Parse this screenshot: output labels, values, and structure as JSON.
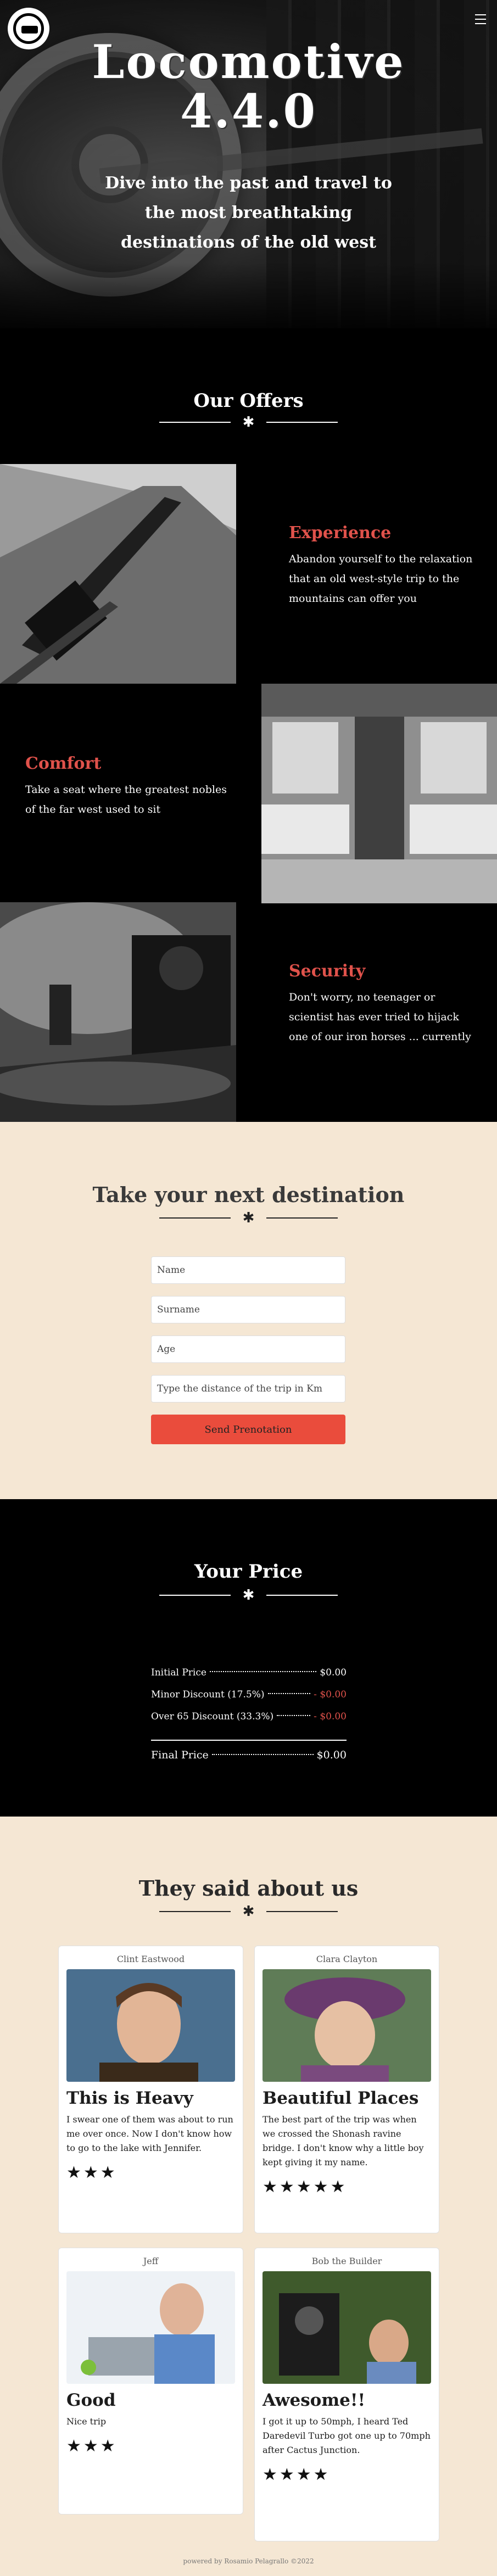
{
  "hero": {
    "title_line1": "Locomotive",
    "title_line2": "4.4.0",
    "subtitle": "Dive into the past and travel to the most breathtaking destinations of the old west"
  },
  "offers": {
    "heading": "Our Offers",
    "items": [
      {
        "title": "Experience",
        "text": "Abandon yourself to the relaxation that an old west-style trip to the mountains can offer you"
      },
      {
        "title": "Comfort",
        "text": "Take a seat where the greatest nobles of the far west used to sit"
      },
      {
        "title": "Security",
        "text": "Don't worry, no teenager or scientist has ever tried to hijack one of our iron horses ... currently"
      }
    ]
  },
  "destination": {
    "heading": "Take your next destination",
    "fields": {
      "name_placeholder": "Name",
      "surname_placeholder": "Surname",
      "age_placeholder": "Age",
      "distance_placeholder": "Type the distance of the trip in Km"
    },
    "submit_label": "Send Prenotation"
  },
  "price": {
    "heading": "Your Price",
    "rows": [
      {
        "label": "Initial Price",
        "value": "$0.00"
      },
      {
        "label": "Minor Discount (17.5%)",
        "value": "- $0.00"
      },
      {
        "label": "Over 65 Discount (33.3%)",
        "value": "- $0.00"
      }
    ],
    "final": {
      "label": "Final Price",
      "value": "$0.00"
    }
  },
  "reviews": {
    "heading": "They said about us",
    "cards": [
      {
        "author": "Clint Eastwood",
        "title": "This is Heavy",
        "text": "I swear one of them was about to run me over once. Now I don't know how to go to the lake with Jennifer.",
        "stars": "★★★"
      },
      {
        "author": "Clara Clayton",
        "title": "Beautiful Places",
        "text": "The best part of the trip was when we crossed the Shonash ravine bridge. I don't know why a little boy kept giving it my name.",
        "stars": "★★★★★"
      },
      {
        "author": "Jeff",
        "title": "Good",
        "text": "Nice trip",
        "stars": "★★★"
      },
      {
        "author": "Bob the Builder",
        "title": "Awesome!!",
        "text": "I got it up to 50mph, I heard Ted Daredevil Turbo got one up to 70mph after Cactus Junction.",
        "stars": "★★★★"
      }
    ]
  },
  "footer": {
    "text": "powered by Rosamio Pelagrallo ©2022"
  },
  "colors": {
    "accent": "#e0524b",
    "cream": "#f5e7d4",
    "button": "#ea4c3c"
  }
}
